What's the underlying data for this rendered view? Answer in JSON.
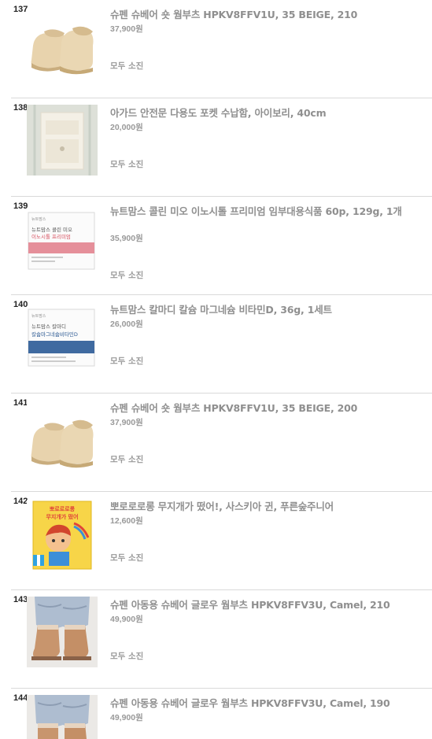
{
  "products": [
    {
      "rank": "137",
      "title": "슈펜 슈베어 숏 웜부츠 HPKV8FFV1U, 35 BEIGE, 210",
      "price": "37,900원",
      "status": "모두 소진",
      "thumb": "beige-boots"
    },
    {
      "rank": "138",
      "title": "아가드 안전문 다용도 포켓 수납함, 아이보리, 40cm",
      "price": "20,000원",
      "status": "모두 소진",
      "thumb": "pocket-organizer"
    },
    {
      "rank": "139",
      "title": "뉴트맘스 콜린 미오 이노시톨 프리미엄 임부대용식품 60p, 129g, 1개",
      "price": "35,900원",
      "status": "모두 소진",
      "thumb": "supplement-box-pink"
    },
    {
      "rank": "140",
      "title": "뉴트맘스 칼마디 칼슘 마그네슘 비타민D, 36g, 1세트",
      "price": "26,000원",
      "status": "모두 소진",
      "thumb": "supplement-box-blue"
    },
    {
      "rank": "141",
      "title": "슈펜 슈베어 숏 웜부츠 HPKV8FFV1U, 35 BEIGE, 200",
      "price": "37,900원",
      "status": "모두 소진",
      "thumb": "beige-boots"
    },
    {
      "rank": "142",
      "title": "뽀로로로롱 무지개가 떴어!, 사스키아 귄, 푸른숲주니어",
      "price": "12,600원",
      "status": "모두 소진",
      "thumb": "picture-book"
    },
    {
      "rank": "143",
      "title": "슈펜 아동용 슈베어 글로우 웜부츠 HPKV8FFV3U, Camel, 210",
      "price": "49,900원",
      "status": "모두 소진",
      "thumb": "camel-boots"
    },
    {
      "rank": "144",
      "title": "슈펜 아동용 슈베어 글로우 웜부츠 HPKV8FFV3U, Camel, 190",
      "price": "49,900원",
      "status": "",
      "thumb": "camel-boots"
    }
  ],
  "thumb_texts": {
    "nutri_brand": "뉴트맘스",
    "box139_line1": "뉴트맘스 콜린 미오",
    "box139_line2": "이노시톨 프리미엄",
    "box140_line1": "뉴트맘스 칼마디",
    "box140_line2": "칼슘마그네슘비타민D",
    "book_title1": "뽀로로로롱",
    "book_title2": "무지개가 떴어"
  }
}
